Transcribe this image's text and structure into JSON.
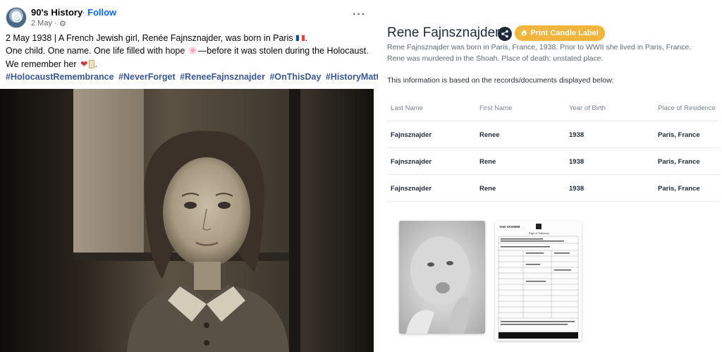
{
  "post": {
    "page_name": "90's History",
    "separator": "·",
    "follow_label": "Follow",
    "date": "2 May ·",
    "gear_icon": "gear-icon",
    "more_icon": "more-icon",
    "line1_text": "2 May 1938 | A French Jewish girl, Renée Fajnsznajder, was born in Paris",
    "line2_before": "One child. One name. One life filled with hope",
    "line2_after": "—before it was stolen during the Holocaust.",
    "line3_text": "We remember her",
    "line3_end": ".",
    "hashtags": [
      "#HolocaustRemembrance",
      "#NeverForget",
      "#ReneeFajnsznajder",
      "#OnThisDay",
      "#HistoryMatters"
    ],
    "link_color": "#385898"
  },
  "record": {
    "name": "Rene Fajnsznajder",
    "candle_label": "Print Candle Label",
    "accent": "#f2b53c",
    "description_1": "Rene Fajnsznajder was born in Paris, France, 1938. Prior to WWII she lived in Paris, France.",
    "description_2": "Rene was murdered in the Shoah. Place of death: unstated place.",
    "info_note": "This information is based on the records/documents displayed below:",
    "table": {
      "headers": [
        "Last Name",
        "First Name",
        "Year of Birth",
        "Place of Residence"
      ],
      "rows": [
        [
          "Fajnsznajder",
          "Renee",
          "1938",
          "Paris, France"
        ],
        [
          "Fajnsznajder",
          "Rene",
          "1938",
          "Paris, France"
        ],
        [
          "Fajnsznajder",
          "Rene",
          "1938",
          "Paris, France"
        ]
      ]
    },
    "doc_header": "YAD VASHEM",
    "doc_title": "Page of Testimony"
  }
}
